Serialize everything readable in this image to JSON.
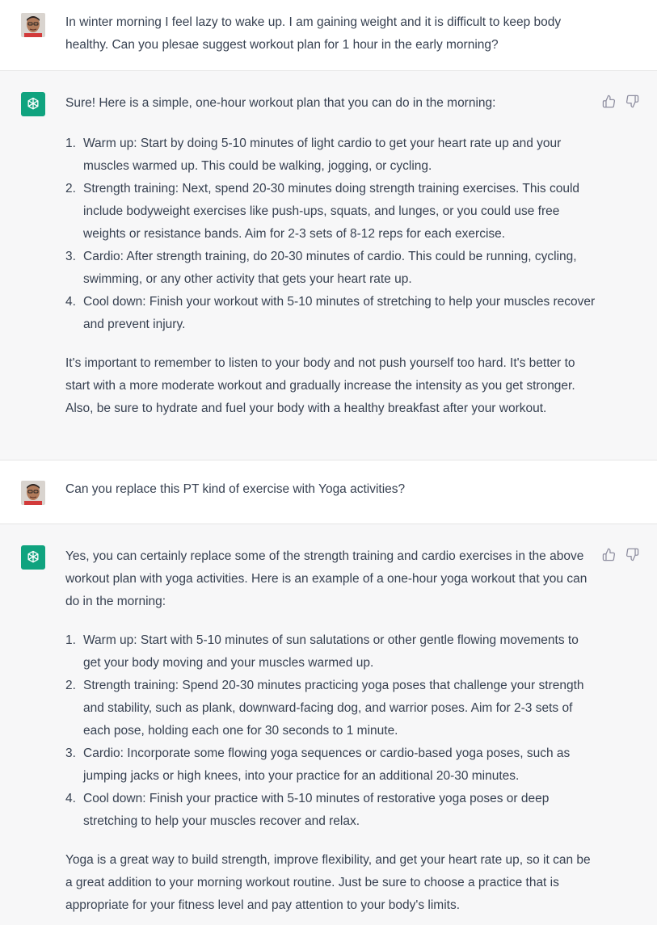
{
  "conversation": [
    {
      "role": "user",
      "text": "In winter morning I feel lazy to wake up. I am gaining weight and it is difficult to keep body healthy. Can you plesae suggest workout plan for 1 hour in the early morning?"
    },
    {
      "role": "assistant",
      "intro": "Sure! Here is a simple, one-hour workout plan that you can do in the morning:",
      "items": [
        "Warm up: Start by doing 5-10 minutes of light cardio to get your heart rate up and your muscles warmed up. This could be walking, jogging, or cycling.",
        "Strength training: Next, spend 20-30 minutes doing strength training exercises. This could include bodyweight exercises like push-ups, squats, and lunges, or you could use free weights or resistance bands. Aim for 2-3 sets of 8-12 reps for each exercise.",
        "Cardio: After strength training, do 20-30 minutes of cardio. This could be running, cycling, swimming, or any other activity that gets your heart rate up.",
        "Cool down: Finish your workout with 5-10 minutes of stretching to help your muscles recover and prevent injury."
      ],
      "outro": "It's important to remember to listen to your body and not push yourself too hard. It's better to start with a more moderate workout and gradually increase the intensity as you get stronger. Also, be sure to hydrate and fuel your body with a healthy breakfast after your workout."
    },
    {
      "role": "user",
      "text": "Can you replace this PT kind of exercise with Yoga activities?"
    },
    {
      "role": "assistant",
      "intro": "Yes, you can certainly replace some of the strength training and cardio exercises in the above workout plan with yoga activities. Here is an example of a one-hour yoga workout that you can do in the morning:",
      "items": [
        "Warm up: Start with 5-10 minutes of sun salutations or other gentle flowing movements to get your body moving and your muscles warmed up.",
        "Strength training: Spend 20-30 minutes practicing yoga poses that challenge your strength and stability, such as plank, downward-facing dog, and warrior poses. Aim for 2-3 sets of each pose, holding each one for 30 seconds to 1 minute.",
        "Cardio: Incorporate some flowing yoga sequences or cardio-based yoga poses, such as jumping jacks or high knees, into your practice for an additional 20-30 minutes.",
        "Cool down: Finish your practice with 5-10 minutes of restorative yoga poses or deep stretching to help your muscles recover and relax."
      ],
      "outro": "Yoga is a great way to build strength, improve flexibility, and get your heart rate up, so it can be a great addition to your morning workout routine. Just be sure to choose a practice that is appropriate for your fitness level and pay attention to your body's limits."
    }
  ],
  "list_numbers": [
    "1.",
    "2.",
    "3.",
    "4."
  ],
  "icons": {
    "user_avatar": "user-avatar",
    "assistant_avatar": "openai-logo-icon",
    "like": "thumbs-up-icon",
    "dislike": "thumbs-down-icon"
  },
  "colors": {
    "assistant_bg": "#f7f7f8",
    "user_bg": "#ffffff",
    "brand": "#10a37f",
    "text": "#374151",
    "icon": "#8e8ea0"
  }
}
